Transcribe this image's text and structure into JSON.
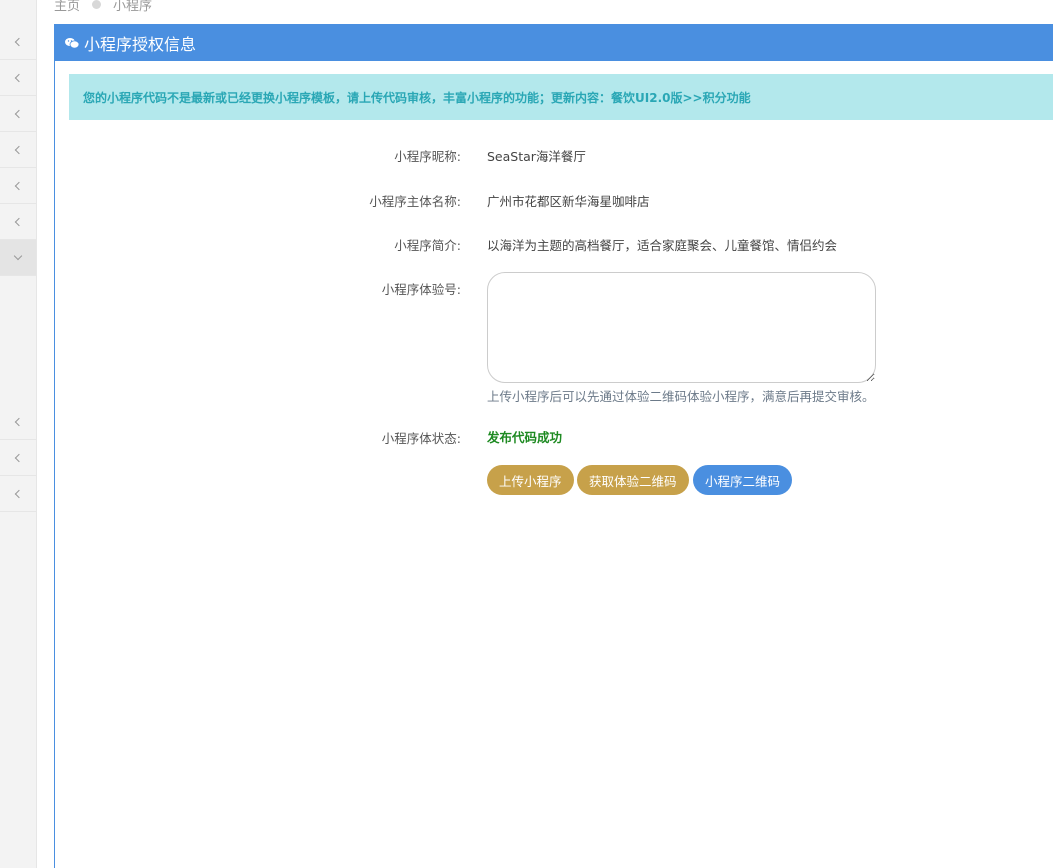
{
  "breadcrumb": {
    "home": "主页",
    "current": "小程序"
  },
  "sidebar": {
    "item_count": 9,
    "active_index": 6
  },
  "panel": {
    "title": "小程序授权信息",
    "title_icon": "wechat-icon"
  },
  "notice": "您的小程序代码不是最新或已经更换小程序模板，请上传代码审核，丰富小程序的功能；更新内容：餐饮UI2.0版>>积分功能",
  "form": {
    "nickname_label": "小程序昵称:",
    "nickname_value": "SeaStar海洋餐厅",
    "entity_label": "小程序主体名称:",
    "entity_value": "广州市花都区新华海星咖啡店",
    "intro_label": "小程序简介:",
    "intro_value": "以海洋为主题的高档餐厅，适合家庭聚会、儿童餐馆、情侣约会",
    "tester_label": "小程序体验号:",
    "tester_value": "",
    "tester_help": "上传小程序后可以先通过体验二维码体验小程序，满意后再提交审核。",
    "status_label": "小程序体状态:",
    "status_value": "发布代码成功"
  },
  "buttons": {
    "upload": "上传小程序",
    "get_qr": "获取体验二维码",
    "mini_qr": "小程序二维码"
  },
  "colors": {
    "primary": "#4a8fe0",
    "notice_bg": "#b3e8ec",
    "notice_text": "#2aa7b5",
    "gold": "#c7a14a",
    "success": "#1e8a22"
  }
}
